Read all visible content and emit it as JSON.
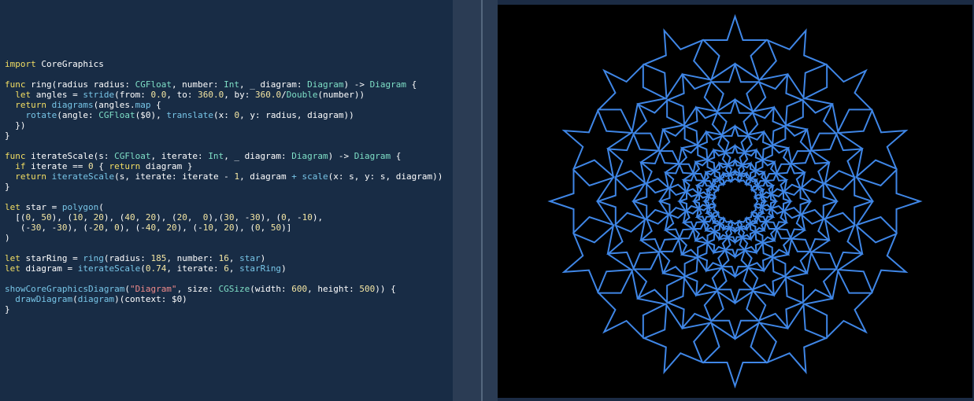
{
  "editor": {
    "lines": [
      [],
      [
        {
          "t": "import",
          "c": "kw"
        },
        {
          "t": " CoreGraphics",
          "c": "pl"
        }
      ],
      [],
      [
        {
          "t": "func",
          "c": "kw"
        },
        {
          "t": " ring(radius radius: ",
          "c": "pl"
        },
        {
          "t": "CGFloat",
          "c": "ty"
        },
        {
          "t": ", number: ",
          "c": "pl"
        },
        {
          "t": "Int",
          "c": "ty"
        },
        {
          "t": ", _ diagram: ",
          "c": "pl"
        },
        {
          "t": "Diagram",
          "c": "ty"
        },
        {
          "t": ") -> ",
          "c": "pl"
        },
        {
          "t": "Diagram",
          "c": "ty"
        },
        {
          "t": " {",
          "c": "pl"
        }
      ],
      [
        {
          "t": "  ",
          "c": "pl"
        },
        {
          "t": "let",
          "c": "kw"
        },
        {
          "t": " angles = ",
          "c": "pl"
        },
        {
          "t": "stride",
          "c": "fn"
        },
        {
          "t": "(from: ",
          "c": "pl"
        },
        {
          "t": "0.0",
          "c": "num"
        },
        {
          "t": ", to: ",
          "c": "pl"
        },
        {
          "t": "360.0",
          "c": "num"
        },
        {
          "t": ", by: ",
          "c": "pl"
        },
        {
          "t": "360.0",
          "c": "num"
        },
        {
          "t": "/",
          "c": "pl"
        },
        {
          "t": "Double",
          "c": "ty"
        },
        {
          "t": "(number))",
          "c": "pl"
        }
      ],
      [
        {
          "t": "  ",
          "c": "pl"
        },
        {
          "t": "return",
          "c": "kw"
        },
        {
          "t": " ",
          "c": "pl"
        },
        {
          "t": "diagrams",
          "c": "fn"
        },
        {
          "t": "(angles.",
          "c": "pl"
        },
        {
          "t": "map",
          "c": "fn"
        },
        {
          "t": " {",
          "c": "pl"
        }
      ],
      [
        {
          "t": "    ",
          "c": "pl"
        },
        {
          "t": "rotate",
          "c": "fn"
        },
        {
          "t": "(angle: ",
          "c": "pl"
        },
        {
          "t": "CGFloat",
          "c": "ty"
        },
        {
          "t": "($0), ",
          "c": "pl"
        },
        {
          "t": "translate",
          "c": "fn"
        },
        {
          "t": "(x: ",
          "c": "pl"
        },
        {
          "t": "0",
          "c": "num"
        },
        {
          "t": ", y: radius, diagram))",
          "c": "pl"
        }
      ],
      [
        {
          "t": "  })",
          "c": "pl"
        }
      ],
      [
        {
          "t": "}",
          "c": "pl"
        }
      ],
      [],
      [
        {
          "t": "func",
          "c": "kw"
        },
        {
          "t": " iterateScale(s: ",
          "c": "pl"
        },
        {
          "t": "CGFloat",
          "c": "ty"
        },
        {
          "t": ", iterate: ",
          "c": "pl"
        },
        {
          "t": "Int",
          "c": "ty"
        },
        {
          "t": ", _ diagram: ",
          "c": "pl"
        },
        {
          "t": "Diagram",
          "c": "ty"
        },
        {
          "t": ") -> ",
          "c": "pl"
        },
        {
          "t": "Diagram",
          "c": "ty"
        },
        {
          "t": " {",
          "c": "pl"
        }
      ],
      [
        {
          "t": "  ",
          "c": "pl"
        },
        {
          "t": "if",
          "c": "kw"
        },
        {
          "t": " iterate == ",
          "c": "pl"
        },
        {
          "t": "0",
          "c": "num"
        },
        {
          "t": " { ",
          "c": "pl"
        },
        {
          "t": "return",
          "c": "kw"
        },
        {
          "t": " diagram }",
          "c": "pl"
        }
      ],
      [
        {
          "t": "  ",
          "c": "pl"
        },
        {
          "t": "return",
          "c": "kw"
        },
        {
          "t": " ",
          "c": "pl"
        },
        {
          "t": "iterateScale",
          "c": "fn"
        },
        {
          "t": "(s, iterate: iterate - ",
          "c": "pl"
        },
        {
          "t": "1",
          "c": "num"
        },
        {
          "t": ", diagram ",
          "c": "pl"
        },
        {
          "t": "+",
          "c": "fn"
        },
        {
          "t": " ",
          "c": "pl"
        },
        {
          "t": "scale",
          "c": "fn"
        },
        {
          "t": "(x: s, y: s, diagram))",
          "c": "pl"
        }
      ],
      [
        {
          "t": "}",
          "c": "pl"
        }
      ],
      [],
      [
        {
          "t": "let",
          "c": "kw"
        },
        {
          "t": " star = ",
          "c": "pl"
        },
        {
          "t": "polygon",
          "c": "fn"
        },
        {
          "t": "(",
          "c": "pl"
        }
      ],
      [
        {
          "t": "  [(",
          "c": "pl"
        },
        {
          "t": "0",
          "c": "num"
        },
        {
          "t": ", ",
          "c": "pl"
        },
        {
          "t": "50",
          "c": "num"
        },
        {
          "t": "), (",
          "c": "pl"
        },
        {
          "t": "10",
          "c": "num"
        },
        {
          "t": ", ",
          "c": "pl"
        },
        {
          "t": "20",
          "c": "num"
        },
        {
          "t": "), (",
          "c": "pl"
        },
        {
          "t": "40",
          "c": "num"
        },
        {
          "t": ", ",
          "c": "pl"
        },
        {
          "t": "20",
          "c": "num"
        },
        {
          "t": "), (",
          "c": "pl"
        },
        {
          "t": "20",
          "c": "num"
        },
        {
          "t": ",  ",
          "c": "pl"
        },
        {
          "t": "0",
          "c": "num"
        },
        {
          "t": "),(",
          "c": "pl"
        },
        {
          "t": "30",
          "c": "num"
        },
        {
          "t": ", -",
          "c": "pl"
        },
        {
          "t": "30",
          "c": "num"
        },
        {
          "t": "), (",
          "c": "pl"
        },
        {
          "t": "0",
          "c": "num"
        },
        {
          "t": ", -",
          "c": "pl"
        },
        {
          "t": "10",
          "c": "num"
        },
        {
          "t": "),",
          "c": "pl"
        }
      ],
      [
        {
          "t": "   (-",
          "c": "pl"
        },
        {
          "t": "30",
          "c": "num"
        },
        {
          "t": ", -",
          "c": "pl"
        },
        {
          "t": "30",
          "c": "num"
        },
        {
          "t": "), (-",
          "c": "pl"
        },
        {
          "t": "20",
          "c": "num"
        },
        {
          "t": ", ",
          "c": "pl"
        },
        {
          "t": "0",
          "c": "num"
        },
        {
          "t": "), (-",
          "c": "pl"
        },
        {
          "t": "40",
          "c": "num"
        },
        {
          "t": ", ",
          "c": "pl"
        },
        {
          "t": "20",
          "c": "num"
        },
        {
          "t": "), (-",
          "c": "pl"
        },
        {
          "t": "10",
          "c": "num"
        },
        {
          "t": ", ",
          "c": "pl"
        },
        {
          "t": "20",
          "c": "num"
        },
        {
          "t": "), (",
          "c": "pl"
        },
        {
          "t": "0",
          "c": "num"
        },
        {
          "t": ", ",
          "c": "pl"
        },
        {
          "t": "50",
          "c": "num"
        },
        {
          "t": ")]",
          "c": "pl"
        }
      ],
      [
        {
          "t": ")",
          "c": "pl"
        }
      ],
      [],
      [
        {
          "t": "let",
          "c": "kw"
        },
        {
          "t": " starRing = ",
          "c": "pl"
        },
        {
          "t": "ring",
          "c": "fn"
        },
        {
          "t": "(radius: ",
          "c": "pl"
        },
        {
          "t": "185",
          "c": "num"
        },
        {
          "t": ", number: ",
          "c": "pl"
        },
        {
          "t": "16",
          "c": "num"
        },
        {
          "t": ", ",
          "c": "pl"
        },
        {
          "t": "star",
          "c": "fn"
        },
        {
          "t": ")",
          "c": "pl"
        }
      ],
      [
        {
          "t": "let",
          "c": "kw"
        },
        {
          "t": " diagram = ",
          "c": "pl"
        },
        {
          "t": "iterateScale",
          "c": "fn"
        },
        {
          "t": "(",
          "c": "pl"
        },
        {
          "t": "0.74",
          "c": "num"
        },
        {
          "t": ", iterate: ",
          "c": "pl"
        },
        {
          "t": "6",
          "c": "num"
        },
        {
          "t": ", ",
          "c": "pl"
        },
        {
          "t": "starRing",
          "c": "fn"
        },
        {
          "t": ")",
          "c": "pl"
        }
      ],
      [],
      [
        {
          "t": "showCoreGraphicsDiagram",
          "c": "fn"
        },
        {
          "t": "(",
          "c": "pl"
        },
        {
          "t": "\"Diagram\"",
          "c": "str"
        },
        {
          "t": ", size: ",
          "c": "pl"
        },
        {
          "t": "CGSize",
          "c": "ty"
        },
        {
          "t": "(width: ",
          "c": "pl"
        },
        {
          "t": "600",
          "c": "num"
        },
        {
          "t": ", height: ",
          "c": "pl"
        },
        {
          "t": "500",
          "c": "num"
        },
        {
          "t": ")) {",
          "c": "pl"
        }
      ],
      [
        {
          "t": "  ",
          "c": "pl"
        },
        {
          "t": "drawDiagram",
          "c": "fn"
        },
        {
          "t": "(",
          "c": "pl"
        },
        {
          "t": "diagram",
          "c": "fn"
        },
        {
          "t": ")(context: $0)",
          "c": "pl"
        }
      ],
      [
        {
          "t": "}",
          "c": "pl"
        }
      ]
    ]
  },
  "preview": {
    "star_points": [
      [
        0,
        50
      ],
      [
        10,
        20
      ],
      [
        40,
        20
      ],
      [
        20,
        0
      ],
      [
        30,
        -30
      ],
      [
        0,
        -10
      ],
      [
        -30,
        -30
      ],
      [
        -20,
        0
      ],
      [
        -40,
        20
      ],
      [
        -10,
        20
      ],
      [
        0,
        50
      ]
    ],
    "ring_radius": 185,
    "ring_number": 16,
    "scale": 0.74,
    "iterate": 6,
    "canvas_width": 600,
    "canvas_height": 500,
    "stroke_color": "#3f86e6",
    "background_color": "#000000"
  }
}
